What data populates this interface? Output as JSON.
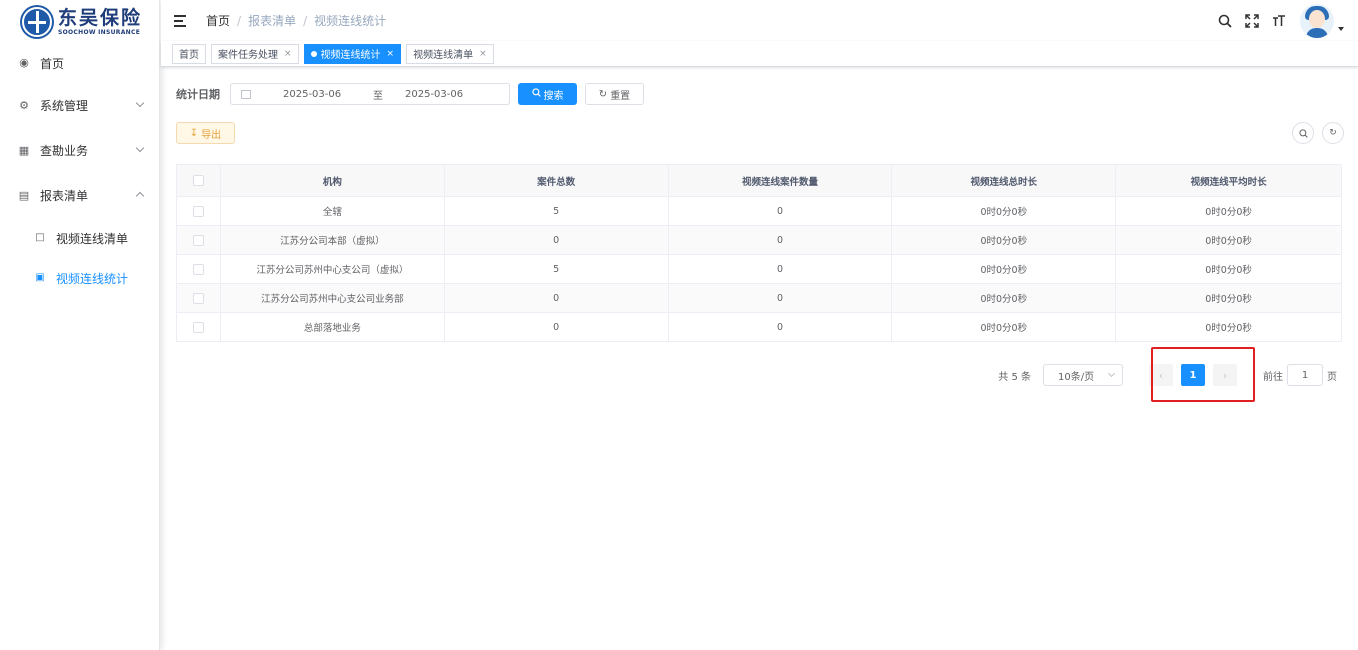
{
  "logo": {
    "cn": "东吴保险",
    "en": "SOOCHOW INSURANCE"
  },
  "sidebar": {
    "items": [
      {
        "label": "首页",
        "icon": "dashboard-icon"
      },
      {
        "label": "系统管理",
        "icon": "gear-icon"
      },
      {
        "label": "查勘业务",
        "icon": "table-icon"
      },
      {
        "label": "报表清单",
        "icon": "report-icon"
      }
    ],
    "subitems": [
      {
        "label": "视频连线清单",
        "icon": "chart-icon"
      },
      {
        "label": "视频连线统计",
        "icon": "stats-icon",
        "active": true
      }
    ]
  },
  "breadcrumb": [
    "首页",
    "报表清单",
    "视频连线统计"
  ],
  "tags": [
    {
      "label": "首页"
    },
    {
      "label": "案件任务处理",
      "close": "×"
    },
    {
      "label": "视频连线统计",
      "close": "×",
      "active": true
    },
    {
      "label": "视频连线清单",
      "close": "×"
    }
  ],
  "search": {
    "label": "统计日期",
    "start": "2025-03-06",
    "separator": "至",
    "end": "2025-03-06",
    "search_btn": "搜索",
    "reset_btn": "重置"
  },
  "toolbar": {
    "export_btn": "导出"
  },
  "table": {
    "headers": [
      "机构",
      "案件总数",
      "视频连线案件数量",
      "视频连线总时长",
      "视频连线平均时长"
    ],
    "rows": [
      [
        "全辖",
        "5",
        "0",
        "0时0分0秒",
        "0时0分0秒"
      ],
      [
        "江苏分公司本部（虚拟）",
        "0",
        "0",
        "0时0分0秒",
        "0时0分0秒"
      ],
      [
        "江苏分公司苏州中心支公司（虚拟）",
        "5",
        "0",
        "0时0分0秒",
        "0时0分0秒"
      ],
      [
        "江苏分公司苏州中心支公司业务部",
        "0",
        "0",
        "0时0分0秒",
        "0时0分0秒"
      ],
      [
        "总部落地业务",
        "0",
        "0",
        "0时0分0秒",
        "0时0分0秒"
      ]
    ]
  },
  "pagination": {
    "total": "共 5 条",
    "page_size": "10条/页",
    "prev": "‹",
    "current": "1",
    "next": "›",
    "goto": "前往",
    "goto_value": "1",
    "page_suffix": "页"
  },
  "colors": {
    "primary": "#1890ff",
    "highlight": "#e02020",
    "warning": "#e6a23c"
  }
}
